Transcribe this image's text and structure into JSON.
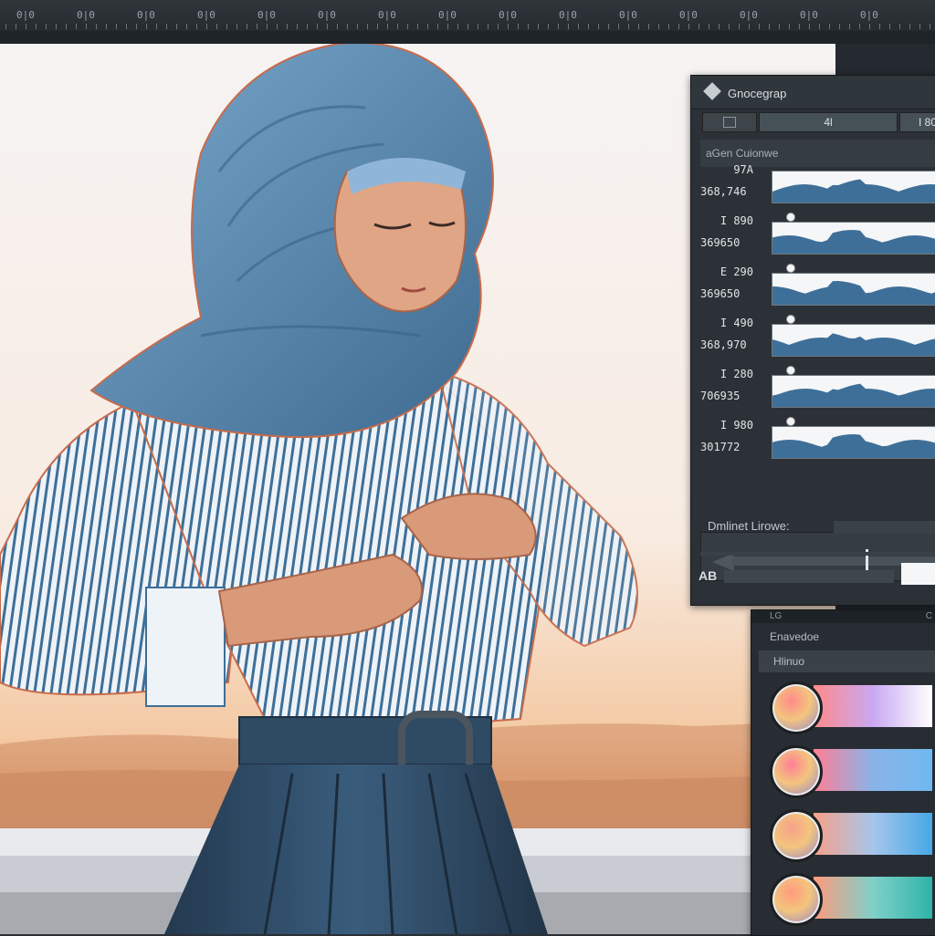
{
  "ruler": {
    "ticks": [
      "0|0",
      "0|0",
      "0|0",
      "0|0",
      "0|0",
      "0|0",
      "0|0",
      "0|0",
      "0|0",
      "0|0",
      "0|0",
      "0|0",
      "0|0",
      "0|0",
      "0|0"
    ]
  },
  "colors": {
    "panel_bg": "#2b3136",
    "panel_border": "#15191c",
    "accent_blue": "#3e6f98",
    "scarf_blue": "#5f8fb8",
    "skirt_navy": "#2b4862",
    "sky_warm": "#f4c9a3"
  },
  "icons": {
    "panel_logo": "diamond-icon",
    "toolbar_image": "image-frame-icon",
    "slider_arrow": "arrow-left-icon"
  },
  "panel": {
    "title": "Gnocegrap",
    "toolbar": {
      "value_a": "4l",
      "value_b": "I 80"
    },
    "section_label": "aGen Cuionwe",
    "histograms": [
      {
        "label1": "97A",
        "label2": "368,746"
      },
      {
        "label1": "I 890",
        "label2": "369650"
      },
      {
        "label1": "E 290",
        "label2": "369650"
      },
      {
        "label1": "I 490",
        "label2": "368,970"
      },
      {
        "label1": "I 280",
        "label2": "706935"
      },
      {
        "label1": "I 980",
        "label2": "301772"
      }
    ],
    "label_field": "Dmlinet Lirowe:",
    "ab_label": "AB"
  },
  "panel2": {
    "header_left": "LG",
    "header_right": "C",
    "title": "Enavedoe",
    "subtitle": "Hlinuo",
    "swatches": [
      {
        "gradient": [
          "#ff8a8a",
          "#c9a8f2",
          "#ffffff"
        ]
      },
      {
        "gradient": [
          "#ff7f96",
          "#8ab3e8",
          "#6fb9f0"
        ]
      },
      {
        "gradient": [
          "#f7a08a",
          "#a6c6ea",
          "#47a8e8"
        ]
      },
      {
        "gradient": [
          "#ff9a7e",
          "#7fd0c8",
          "#2fb4a8"
        ]
      }
    ]
  }
}
